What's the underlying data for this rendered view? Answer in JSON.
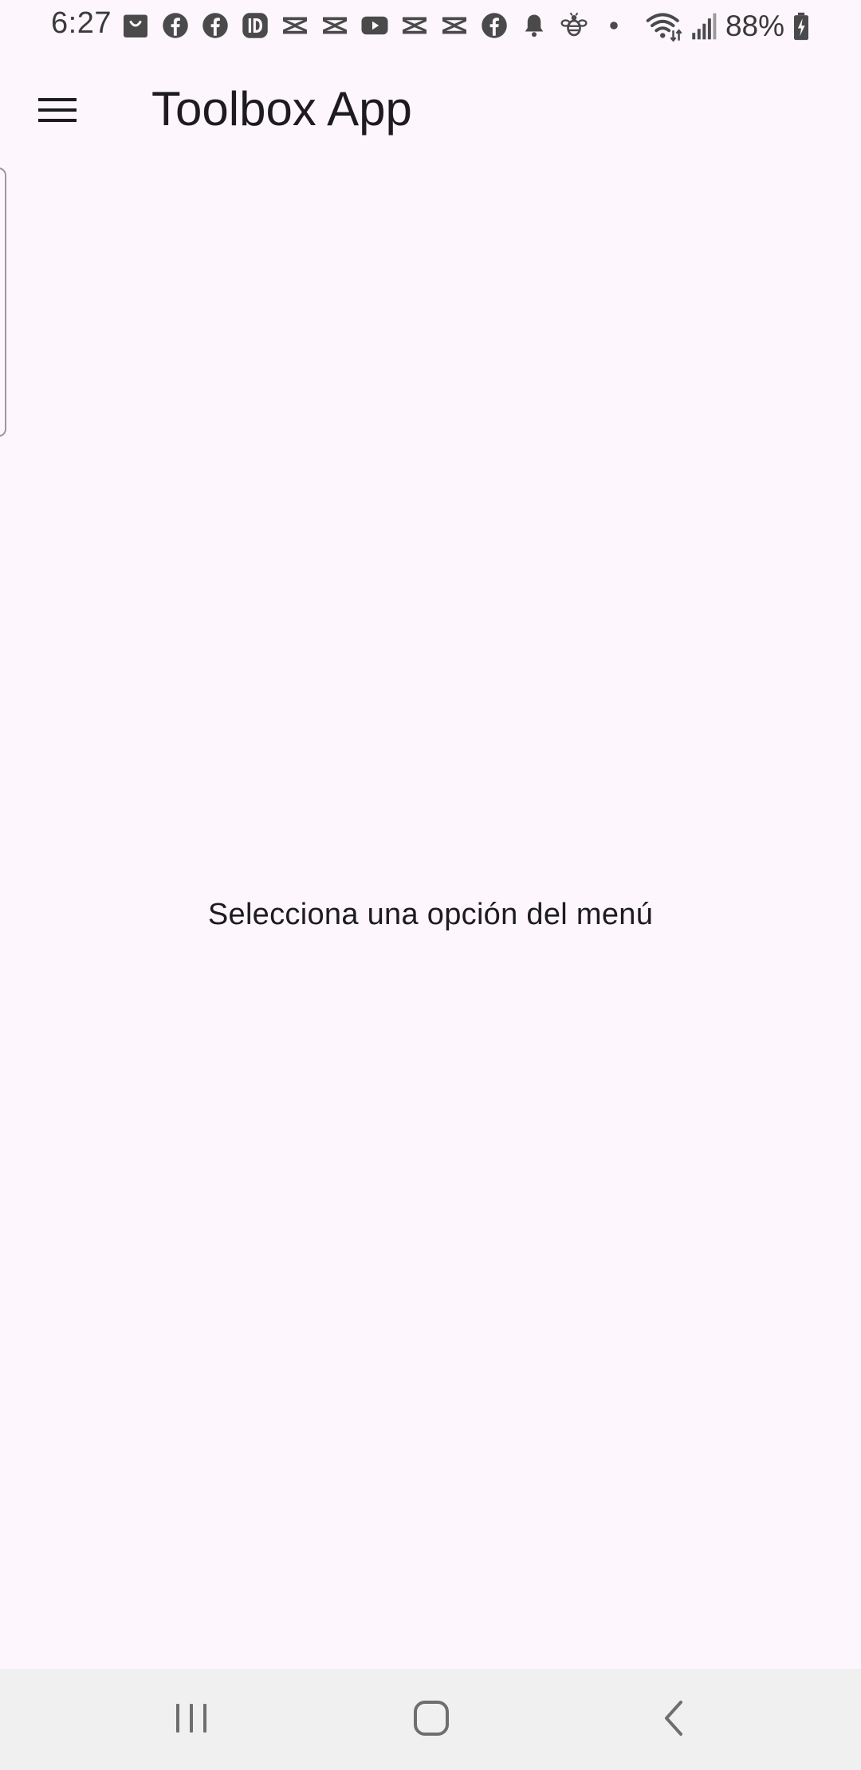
{
  "status_bar": {
    "time": "6:27",
    "battery": "88%",
    "notification_icons": [
      "shopping-bag-icon",
      "facebook-icon",
      "facebook-icon",
      "id-app-icon",
      "capcut-icon",
      "capcut-icon",
      "youtube-icon",
      "capcut-icon",
      "capcut-icon",
      "facebook-icon",
      "bell-icon",
      "bee-icon",
      "more-dot-icon"
    ],
    "system_icons": [
      "wifi-icon",
      "signal-icon",
      "battery-charging-icon"
    ]
  },
  "app_bar": {
    "title": "Toolbox App",
    "menu_icon": "hamburger-menu-icon"
  },
  "body": {
    "message": "Selecciona una opción del menú"
  },
  "nav_bar": {
    "buttons": [
      "recents-icon",
      "home-icon",
      "back-icon"
    ]
  },
  "colors": {
    "background": "#FDF7FD",
    "text": "#1D1B20",
    "nav_bar": "#F1F0F1",
    "status_icons": "#4A4A4A"
  }
}
